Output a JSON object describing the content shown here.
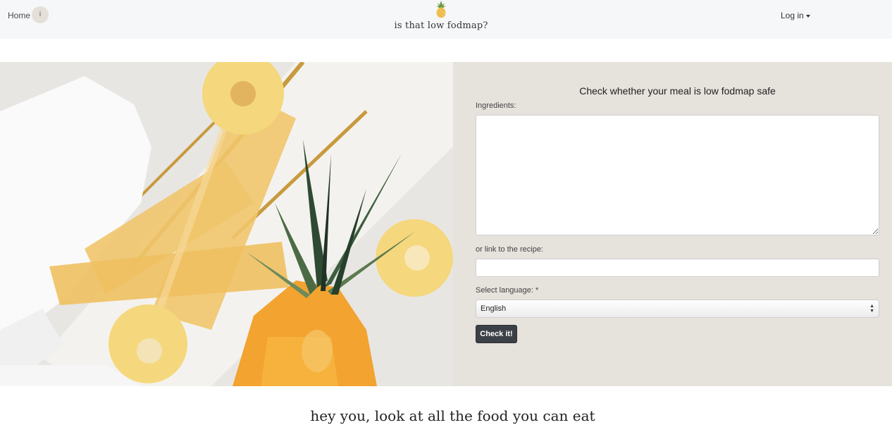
{
  "nav": {
    "home_label": "Home",
    "info_label": "i",
    "brand": "is that low fodmap?",
    "login_label": "Log in"
  },
  "form": {
    "title": "Check whether your meal is low fodmap safe",
    "ingredients_label": "Ingredients:",
    "ingredients_value": "",
    "recipe_label": "or link to the recipe:",
    "recipe_value": "",
    "language_label": "Select language: *",
    "language_selected": "English",
    "submit_label": "Check it!"
  },
  "tagline": "hey you, look at all the food you can eat",
  "colors": {
    "navbar_bg": "#f6f7f9",
    "panel_bg": "#e6e2dc",
    "button_bg": "#3c4148",
    "pineapple_yellow": "#f3c456"
  },
  "icons": {
    "brand_logo": "pineapple-icon"
  }
}
